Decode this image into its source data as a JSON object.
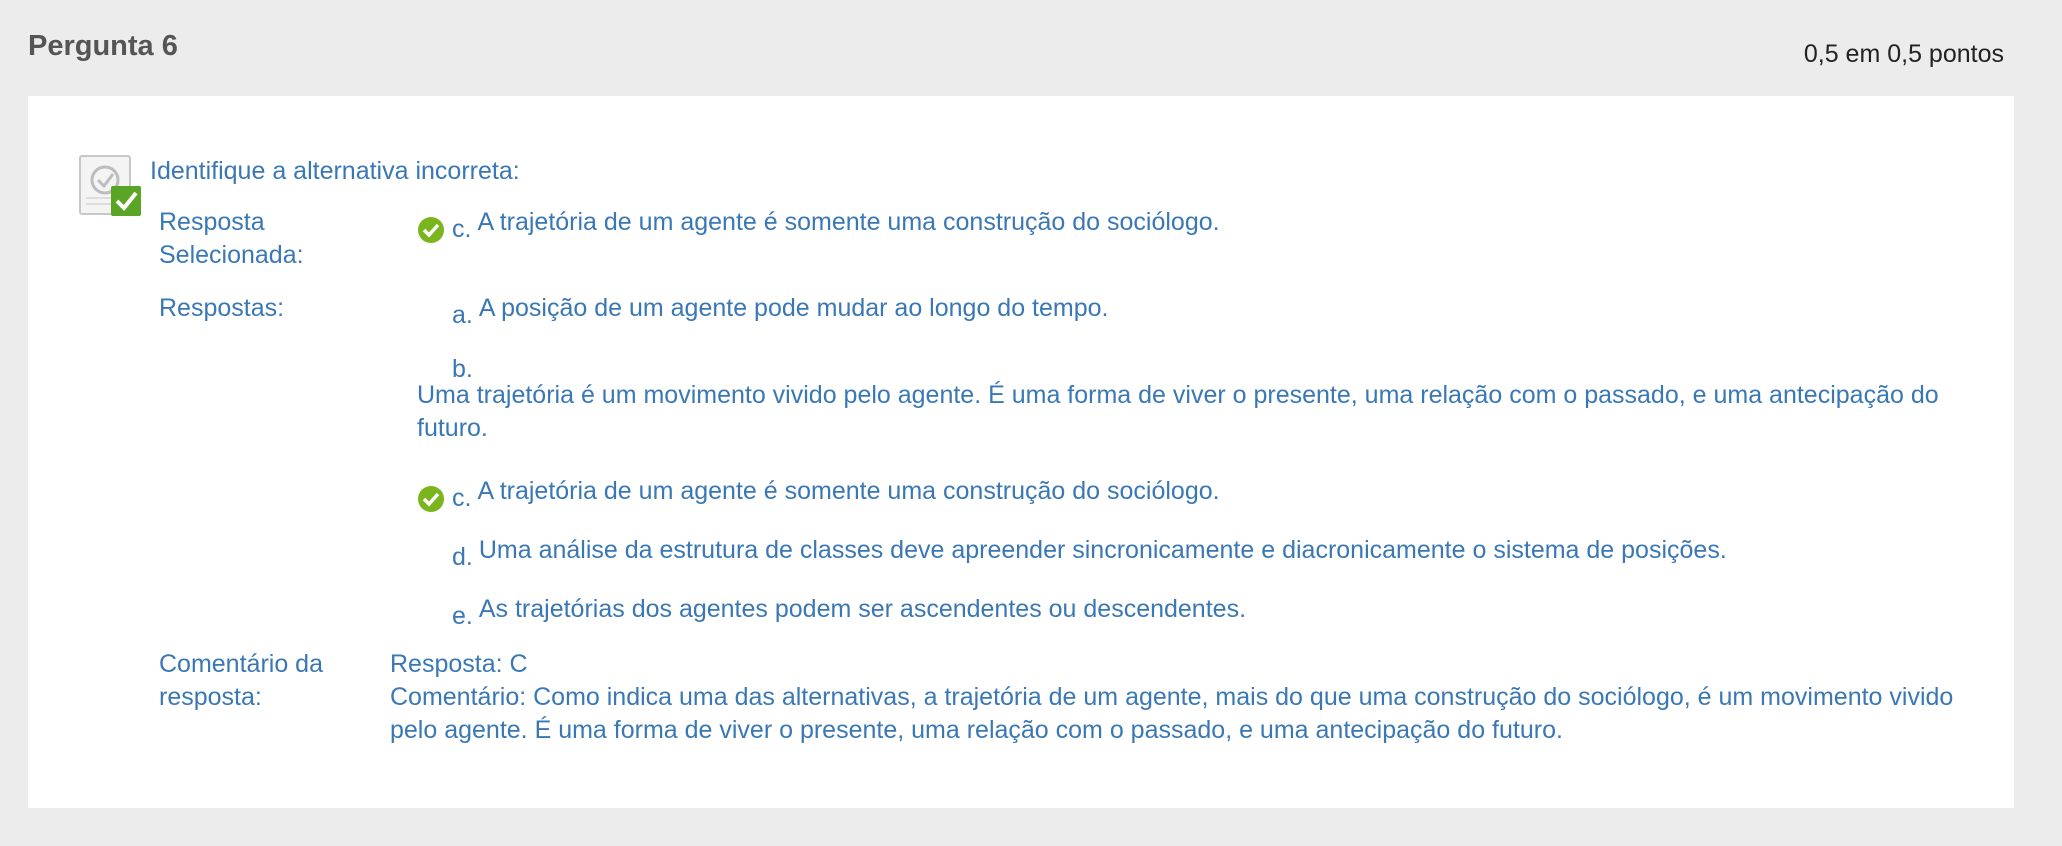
{
  "question": {
    "title": "Pergunta 6",
    "points": "0,5 em 0,5 pontos",
    "prompt": "Identifique a alternativa incorreta:",
    "status_icon": "question-correct-icon"
  },
  "labels": {
    "selected": "Resposta Selecionada:",
    "answers": "Respostas:",
    "comment": "Comentário da resposta:"
  },
  "selected_answer": {
    "letter": "c.",
    "text": "A trajetória de um agente é somente uma construção do sociólogo.",
    "icon": "correct-check-icon"
  },
  "answers": [
    {
      "letter": "a.",
      "text": "A posição de um agente pode mudar ao longo do tempo.",
      "correct": false
    },
    {
      "letter": "b.",
      "text": "Uma trajetória é um movimento vivido pelo agente. É uma forma de viver o presente, uma relação com o passado, e uma antecipação do futuro.",
      "correct": false
    },
    {
      "letter": "c.",
      "text": "A trajetória de um agente é somente uma construção do sociólogo.",
      "correct": true
    },
    {
      "letter": "d.",
      "text": "Uma análise da estrutura de classes deve apreender sincronicamente e diacronicamente o sistema de posições.",
      "correct": false
    },
    {
      "letter": "e.",
      "text": "As trajetórias dos agentes podem ser ascendentes ou descendentes.",
      "correct": false
    }
  ],
  "comment": {
    "answer": "Resposta: C",
    "text": "Comentário: Como indica uma das alternativas, a trajetória de um agente, mais do que uma construção do sociólogo, é um movimento vivido pelo agente. É uma forma de viver o presente, uma relação com o passado, e uma antecipação do futuro."
  },
  "colors": {
    "text_blue": "#3a78b5",
    "check_green": "#7ab51d",
    "page_bg": "#ececec"
  }
}
